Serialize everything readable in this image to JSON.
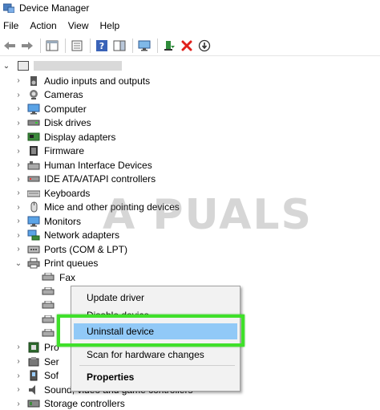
{
  "window": {
    "title": "Device Manager"
  },
  "menu": [
    "File",
    "Action",
    "View",
    "Help"
  ],
  "tree": {
    "categories": [
      {
        "label": "Audio inputs and outputs"
      },
      {
        "label": "Cameras"
      },
      {
        "label": "Computer"
      },
      {
        "label": "Disk drives"
      },
      {
        "label": "Display adapters"
      },
      {
        "label": "Firmware"
      },
      {
        "label": "Human Interface Devices"
      },
      {
        "label": "IDE ATA/ATAPI controllers"
      },
      {
        "label": "Keyboards"
      },
      {
        "label": "Mice and other pointing devices"
      },
      {
        "label": "Monitors"
      },
      {
        "label": "Network adapters"
      },
      {
        "label": "Ports (COM & LPT)"
      },
      {
        "label": "Print queues"
      }
    ],
    "print_children": [
      "Fax"
    ],
    "partial_after": [
      "Pro",
      "Ser",
      "Sof",
      "Sound, video and game controllers",
      "Storage controllers"
    ]
  },
  "watermark": "A PUALS",
  "context_menu": {
    "items": [
      "Update driver",
      "Disable device",
      "Uninstall device",
      "Scan for hardware changes",
      "Properties"
    ],
    "highlighted_index": 2
  },
  "colors": {
    "highlight": "#91c9f7",
    "annotation": "#3fe02a",
    "delete_red": "#e0201b"
  }
}
